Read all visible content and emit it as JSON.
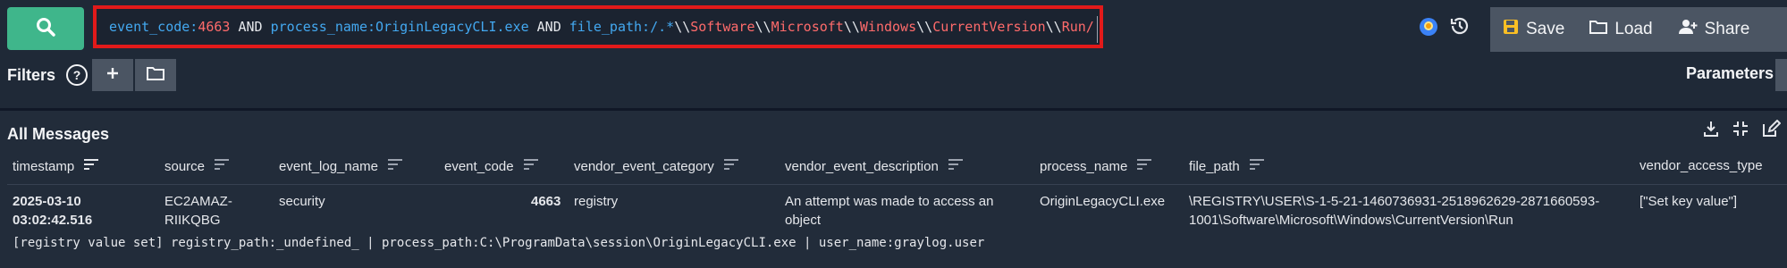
{
  "search": {
    "query_parts": [
      {
        "t": "event_code:",
        "c": "key"
      },
      {
        "t": "4663",
        "c": "num"
      },
      {
        "t": " AND ",
        "c": "op"
      },
      {
        "t": "process_name:",
        "c": "key"
      },
      {
        "t": "OriginLegacyCLI.exe",
        "c": "key"
      },
      {
        "t": " AND ",
        "c": "op"
      },
      {
        "t": "file_path:",
        "c": "key"
      },
      {
        "t": "/.*",
        "c": "key"
      },
      {
        "t": "\\\\",
        "c": "plain"
      },
      {
        "t": "Software",
        "c": "red"
      },
      {
        "t": "\\\\",
        "c": "plain"
      },
      {
        "t": "Microsoft",
        "c": "red"
      },
      {
        "t": "\\\\",
        "c": "plain"
      },
      {
        "t": "Windows",
        "c": "red"
      },
      {
        "t": "\\\\",
        "c": "plain"
      },
      {
        "t": "CurrentVersion",
        "c": "red"
      },
      {
        "t": "\\\\",
        "c": "plain"
      },
      {
        "t": "Run/",
        "c": "red"
      }
    ]
  },
  "toolbar": {
    "save_label": "Save",
    "load_label": "Load",
    "share_label": "Share"
  },
  "filters": {
    "label": "Filters",
    "help": "?",
    "parameters_label": "Parameters"
  },
  "messages": {
    "title": "All Messages",
    "columns": [
      "timestamp",
      "source",
      "event_log_name",
      "event_code",
      "vendor_event_category",
      "vendor_event_description",
      "process_name",
      "file_path",
      "vendor_access_type"
    ],
    "row": {
      "timestamp_line1": "2025-03-10",
      "timestamp_line2": "03:02:42.516",
      "source_line1": "EC2AMAZ-",
      "source_line2": "RIIKQBG",
      "event_log_name": "security",
      "event_code": "4663",
      "vendor_event_category": "registry",
      "vendor_event_description_line1": "An attempt was made to access an",
      "vendor_event_description_line2": "object",
      "process_name": "OriginLegacyCLI.exe",
      "file_path_line1": "\\REGISTRY\\USER\\S-1-5-21-1460736931-2518962629-2871660593-",
      "file_path_line2": "1001\\Software\\Microsoft\\Windows\\CurrentVersion\\Run",
      "vendor_access_type": "[\"Set key value\"]",
      "message": "[registry value set] registry_path:_undefined_ | process_path:C:\\ProgramData\\session\\OriginLegacyCLI.exe | user_name:graylog.user"
    }
  },
  "colors": {
    "accent_green": "#3fb68b",
    "highlight_red": "#e21a1a",
    "field_blue": "#43a8f0",
    "value_red": "#ff6b6b"
  }
}
